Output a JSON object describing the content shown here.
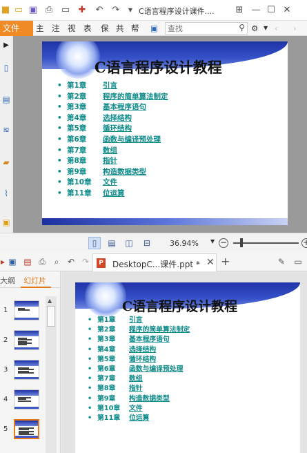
{
  "top_window": {
    "title": "C语言程序设计课件....",
    "menu_file": "文件",
    "menu_items": [
      "主",
      "注",
      "视",
      "表",
      "保",
      "共",
      "帮"
    ],
    "search_placeholder": "查找",
    "zoom": "36.94%",
    "slide": {
      "title": "C语言程序设计教程",
      "chapters": [
        {
          "num": "第1章",
          "topic": "引言"
        },
        {
          "num": "第2章",
          "topic": "程序的简单算法制定"
        },
        {
          "num": "第3章",
          "topic": "基本程序语句"
        },
        {
          "num": "第4章",
          "topic": "选择结构"
        },
        {
          "num": "第5章",
          "topic": "循环结构"
        },
        {
          "num": "第6章",
          "topic": "函数与编译预处理"
        },
        {
          "num": "第7章",
          "topic": "数组"
        },
        {
          "num": "第8章",
          "topic": "指针"
        },
        {
          "num": "第9章",
          "topic": "构造数据类型"
        },
        {
          "num": "第10章",
          "topic": "文件"
        },
        {
          "num": "第11章",
          "topic": "位运算"
        }
      ]
    }
  },
  "bottom_window": {
    "tab_label": "DesktopC...课件.ppt *",
    "pane_tab_outline": "大纲",
    "pane_tab_slides": "幻灯片",
    "slide_numbers": [
      "1",
      "2",
      "3",
      "4",
      "5"
    ],
    "selected_slide": 5
  },
  "colors": {
    "accent_orange": "#f08a24",
    "chapter_teal": "#0d8a8a",
    "slide_blue": "#2d46b8"
  }
}
